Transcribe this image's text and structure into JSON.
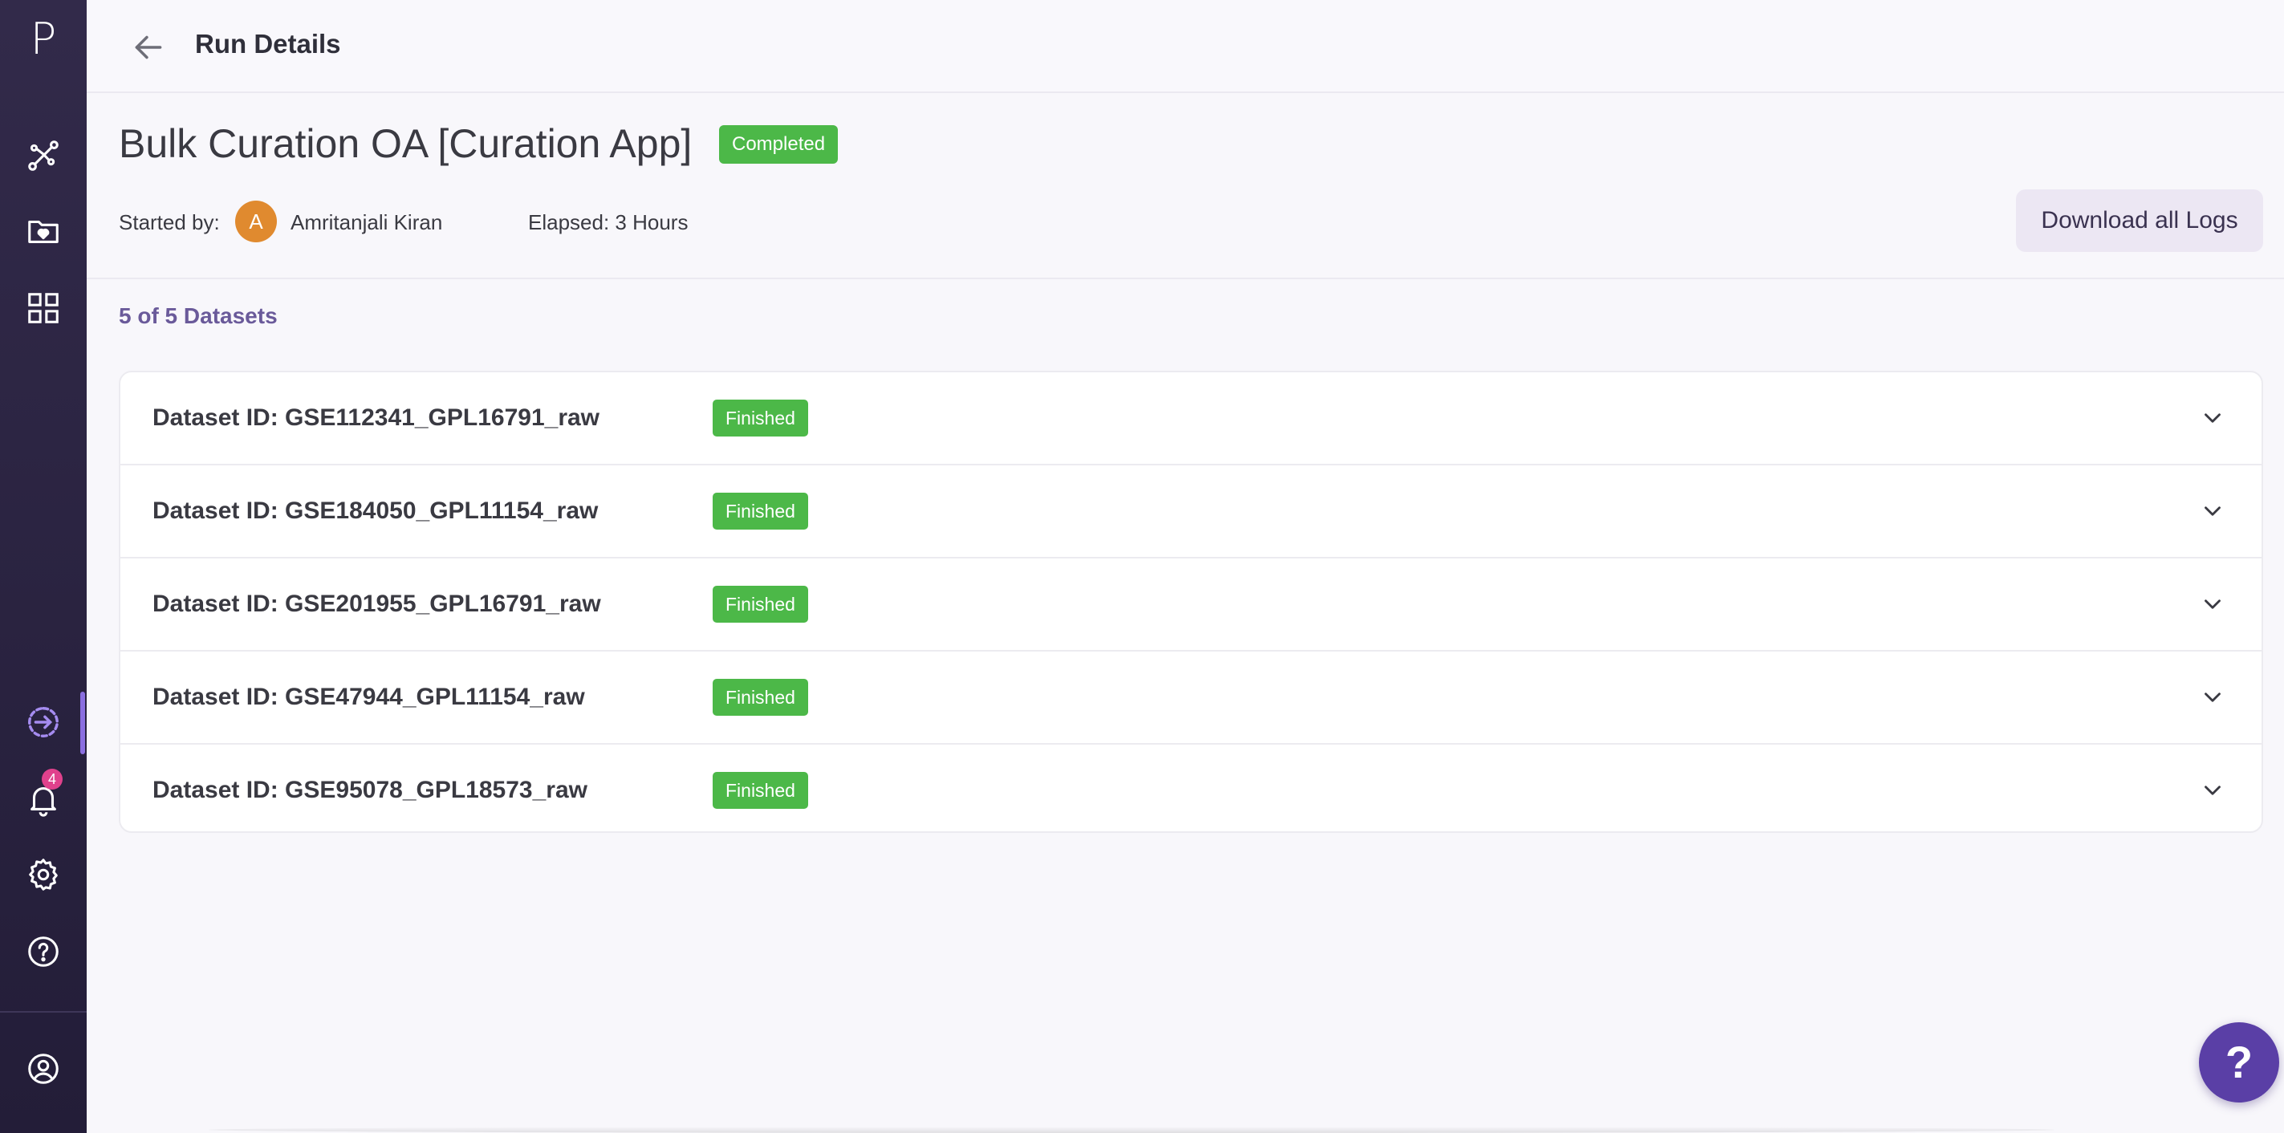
{
  "sidebar": {
    "logo": "P",
    "notification_count": "4",
    "icons": [
      "workflow-icon",
      "folder-heart-icon",
      "apps-grid-icon",
      "runs-icon",
      "bell-icon",
      "gear-icon",
      "help-circle-icon",
      "user-circle-icon"
    ]
  },
  "header": {
    "title": "Run Details"
  },
  "run": {
    "name": "Bulk Curation OA [Curation App]",
    "status": "Completed",
    "started_by_label": "Started by:",
    "avatar_initial": "A",
    "user_name": "Amritanjali Kiran",
    "elapsed": "Elapsed: 3 Hours",
    "download_label": "Download all Logs"
  },
  "datasets": {
    "count_label": "5 of 5 Datasets",
    "items": [
      {
        "id": "Dataset ID: GSE112341_GPL16791_raw",
        "status": "Finished"
      },
      {
        "id": "Dataset ID: GSE184050_GPL11154_raw",
        "status": "Finished"
      },
      {
        "id": "Dataset ID: GSE201955_GPL16791_raw",
        "status": "Finished"
      },
      {
        "id": "Dataset ID: GSE47944_GPL11154_raw",
        "status": "Finished"
      },
      {
        "id": "Dataset ID: GSE95078_GPL18573_raw",
        "status": "Finished"
      }
    ]
  },
  "help_fab": "?",
  "colors": {
    "accent": "#5a3fa6",
    "success": "#4cb848",
    "sidebar": "#2b2440"
  }
}
